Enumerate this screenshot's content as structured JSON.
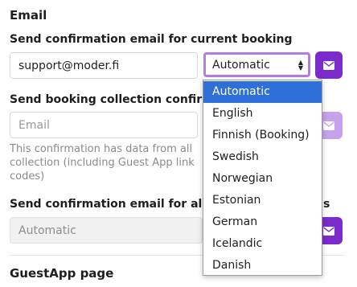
{
  "section_title": "Email",
  "current_booking": {
    "label": "Send confirmation email for current booking",
    "email_value": "support@moder.fi",
    "language_value": "Automatic"
  },
  "collection": {
    "label": "Send booking collection confirm",
    "email_placeholder": "Email",
    "help_text": "This confirmation has data from all\ncollection (including Guest App link\ncodes)"
  },
  "all": {
    "label_left": "Send confirmation email for all c",
    "label_right": "s",
    "select_value": "Automatic"
  },
  "guestapp_title": "GuestApp page",
  "dropdown": {
    "options": [
      "Automatic",
      "English",
      "Finnish (Booking)",
      "Swedish",
      "Norwegian",
      "Estonian",
      "German",
      "Icelandic",
      "Danish"
    ],
    "selected_index": 0
  },
  "colors": {
    "accent": "#7b2bc9",
    "focus_ring": "#b07de0",
    "selected_option": "#2f6fd8"
  },
  "icons": {
    "send": "envelope-icon",
    "select": "up-down-arrows-icon"
  }
}
